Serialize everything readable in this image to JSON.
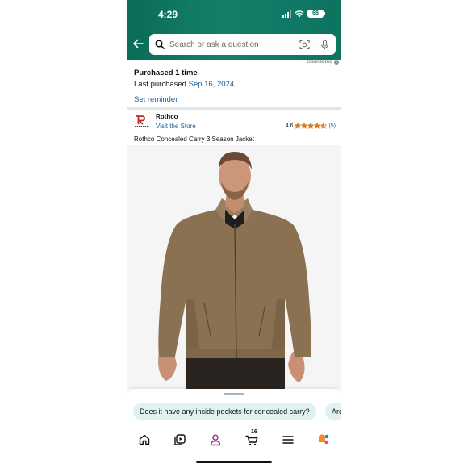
{
  "status_bar": {
    "time": "4:29",
    "battery": "68"
  },
  "search": {
    "placeholder": "Search or ask a question"
  },
  "sponsored": {
    "label": "Sponsored"
  },
  "purchase": {
    "title": "Purchased 1 time",
    "last_prefix": "Last purchased",
    "last_date": "Sep 16, 2024",
    "reminder": "Set reminder"
  },
  "brand": {
    "name": "Rothco",
    "visit": "Visit the Store",
    "rating": "4.6",
    "rating_stars": 4.6,
    "review_count": "(5)"
  },
  "product": {
    "title": "Rothco Concealed Carry 3 Season Jacket"
  },
  "suggestions": [
    {
      "label": "Does it have any inside pockets for concealed carry?"
    },
    {
      "label": "Are"
    }
  ],
  "tabbar": {
    "cart_count": "16"
  },
  "colors": {
    "header": "#0b6b57",
    "link": "#2162a1",
    "star": "#de7921",
    "chip": "#dff1f1"
  },
  "icons": [
    "back-arrow-icon",
    "search-icon",
    "camera-lens-icon",
    "microphone-icon",
    "home-icon",
    "video-play-icon",
    "profile-icon",
    "cart-icon",
    "menu-icon",
    "rufus-icon"
  ]
}
